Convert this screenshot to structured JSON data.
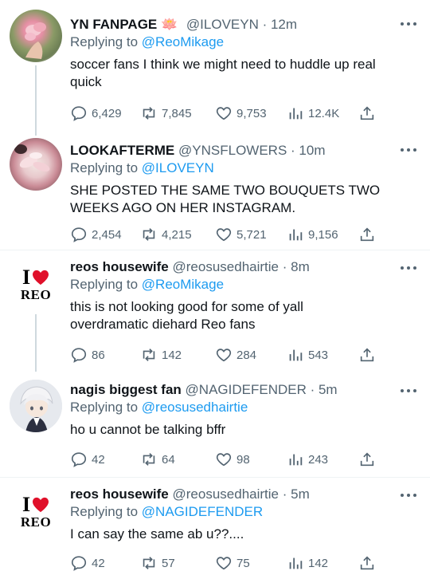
{
  "tweets": [
    {
      "name": "YN FANPAGE",
      "name_emoji": "🪷",
      "handle": "@ILOVEYN",
      "time": "12m",
      "reply_prefix": "Replying to",
      "reply_to": "@ReoMikage",
      "text": "soccer fans I think we might need to huddle up real quick",
      "replies": "6,429",
      "retweets": "7,845",
      "likes": "9,753",
      "views": "12.4K"
    },
    {
      "name": "LOOKAFTERME",
      "handle": "@YNSFLOWERS",
      "time": "10m",
      "reply_prefix": "Replying to",
      "reply_to": "@ILOVEYN",
      "text": "SHE POSTED THE SAME TWO BOUQUETS TWO WEEKS AGO ON HER INSTAGRAM.",
      "replies": "2,454",
      "retweets": "4,215",
      "likes": "5,721",
      "views": "9,156"
    },
    {
      "name": "reos housewife",
      "handle": "@reosusedhairtie",
      "time": "8m",
      "reply_prefix": "Replying to",
      "reply_to": "@ReoMikage",
      "text": "this is not looking good for some of yall overdramatic diehard Reo fans",
      "replies": "86",
      "retweets": "142",
      "likes": "284",
      "views": "543",
      "avatar_top": "I",
      "avatar_bottom": "REO"
    },
    {
      "name": "nagis biggest fan",
      "handle": "@NAGIDEFENDER",
      "time": "5m",
      "reply_prefix": "Replying to",
      "reply_to": "@reosusedhairtie",
      "text": "ho u cannot be talking bffr",
      "replies": "42",
      "retweets": "64",
      "likes": "98",
      "views": "243"
    },
    {
      "name": "reos housewife",
      "handle": "@reosusedhairtie",
      "time": "5m",
      "reply_prefix": "Replying to",
      "reply_to": "@NAGIDEFENDER",
      "text": "I can say the same ab u??....",
      "replies": "42",
      "retweets": "57",
      "likes": "75",
      "views": "142",
      "avatar_top": "I",
      "avatar_bottom": "REO"
    }
  ],
  "icons": {
    "reply": "reply-icon",
    "retweet": "retweet-icon",
    "like": "heart-icon",
    "views": "views-icon",
    "share": "share-icon",
    "more": "more-icon"
  },
  "colors": {
    "link": "#1d9bf0",
    "secondary_text": "#536471",
    "heart_logo": "#e0102a"
  }
}
